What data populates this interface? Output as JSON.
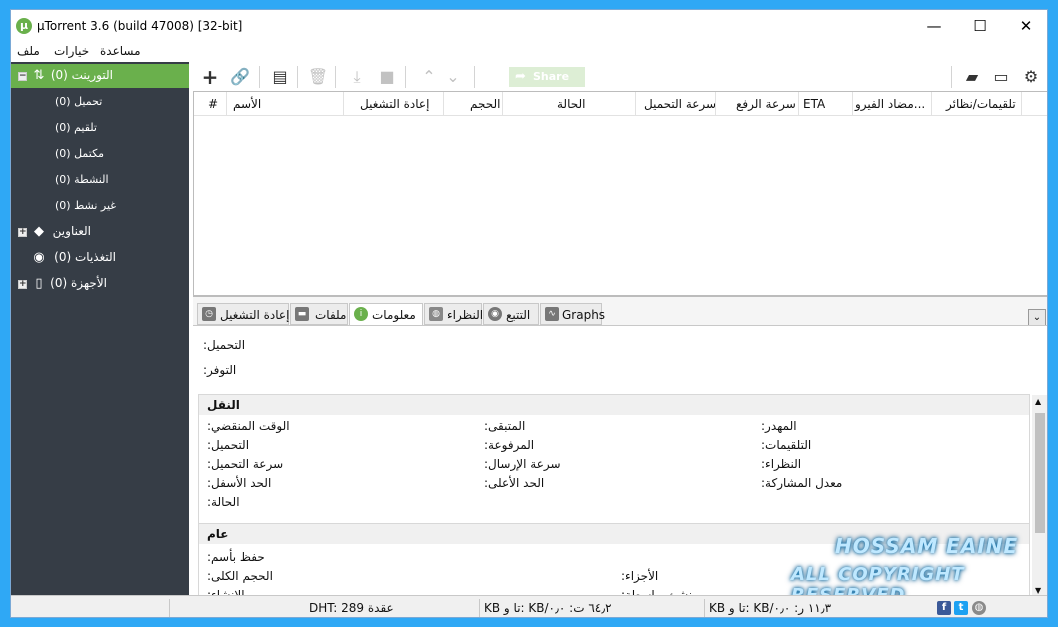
{
  "window": {
    "title": "µTorrent 3.6  (build 47008) [32-bit]",
    "logo_glyph": "µ",
    "minimize": "—",
    "maximize": "☐",
    "close": "✕"
  },
  "menu": {
    "file": "ملف",
    "options": "خيارات",
    "help": "مساعدة"
  },
  "sidebar": {
    "torrents": "التورينت (0)",
    "downloading": "(0) تحميل",
    "seeding": "(0) تلقيم",
    "completed": "(0) مكتمل",
    "active": "(0) النشطة",
    "inactive": "(0) غير نشط",
    "labels": "العناوين",
    "feeds": "التغذيات (0)",
    "devices": "الأجهزة (0)"
  },
  "toolbar": {
    "share_label": "Share",
    "icons": [
      "add-torrent-icon",
      "add-link-icon",
      "create-torrent-icon",
      "remove-icon",
      "start-icon",
      "stop-icon",
      "move-up-icon",
      "move-down-icon",
      "share-icon",
      "chat-icon",
      "remote-icon",
      "settings-icon"
    ]
  },
  "columns": {
    "num": "#",
    "name": "الأسم",
    "playback": "إعادة التشغيل",
    "size": "الحجم",
    "status": "الحالة",
    "down_speed": "سرعة التحميل",
    "up_speed": "سرعة الرفع",
    "eta": "ETA",
    "antivirus": "مضاد الفيرو...",
    "seeds_peers": "تلقيمات/نظائر"
  },
  "tabs": {
    "playback": "إعادة التشغيل",
    "files": "ملفات",
    "info": "معلومات",
    "peers": "النظراء",
    "trackers": "التتبع",
    "graphs": "Graphs",
    "collapse": "⌄"
  },
  "info": {
    "downloaded": ":التحميل",
    "availability": ":التوفر",
    "transfer_head": "النقل",
    "elapsed": ":الوقت المنقضي",
    "remaining": ":المتبقى",
    "wasted": ":المهدر",
    "downloaded2": ":التحميل",
    "uploaded": ":المرفوعة",
    "seeds": ":التلقيمات",
    "dl_speed": ":سرعة التحميل",
    "ul_speed": ":سرعة الإرسال",
    "peers": ":النظراء",
    "down_limit": ":الحد الأسفل",
    "up_limit": ":الحد الأعلى",
    "share_ratio": ":معدل المشاركة",
    "status": ":الحالة",
    "general_head": "عام",
    "save_as": ":حفظ بأسم",
    "total_size": ":الحجم الكلى",
    "pieces": ":الأجزاء",
    "created_on": ":الإنشاء",
    "created_by": ":منشئ بواسطة"
  },
  "status": {
    "dht": "DHT: 289 عقدة",
    "download": "KB تا و: KB/٦٤٫٢ ت: ٠٫٠",
    "upload": "KB تا و: KB/١١٫٣ ر: ٠٫٠"
  },
  "watermark": {
    "line1": "HOSSAM EAINE",
    "line2": "ALL COPYRIGHT RESERVED"
  },
  "colors": {
    "accent": "#6ab04c",
    "sidebar_bg": "#363d46",
    "desktop": "#2fa8f5"
  }
}
